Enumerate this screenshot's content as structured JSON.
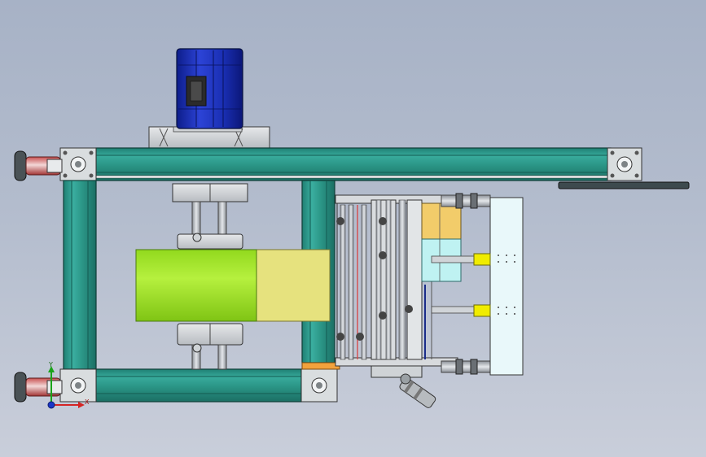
{
  "viewport": {
    "background_top": "#a7b2c6",
    "background_bottom": "#c9ceda"
  },
  "colors": {
    "aluminum_profile": "#2f9a8c",
    "motor_housing": "#1c2fb0",
    "green_roller": "#a5e62a",
    "yellow_belt": "#e6e27e",
    "orange_box": "#f2cc6a",
    "cyan_box": "#bff2f2",
    "yellow_sensor": "#f0ec00",
    "orange_plate": "#f2a23c",
    "light_panel": "#e9f8fa"
  },
  "triad": {
    "y_label": "Y",
    "x_label": "X"
  },
  "icons": [
    "motor-icon",
    "coordinate-triad-icon",
    "leveling-foot-icon",
    "sensor-icon"
  ]
}
